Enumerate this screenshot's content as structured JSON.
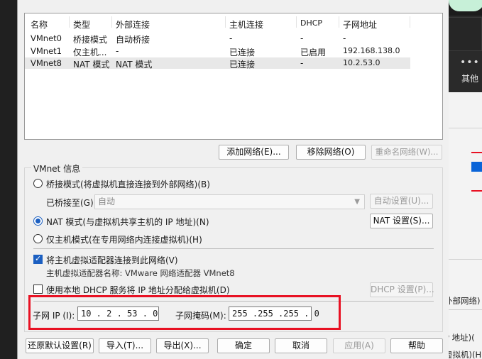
{
  "background_app": {
    "dots": "•••",
    "other_label": "其他",
    "text_right_1": "外部网络)",
    "text_right_2": "P 地址)(",
    "text_right_3": "虚拟机)(H"
  },
  "network_table": {
    "headers": [
      "名称",
      "类型",
      "外部连接",
      "主机连接",
      "DHCP",
      "子网地址"
    ],
    "rows": [
      {
        "name": "VMnet0",
        "type": "桥接模式",
        "external": "自动桥接",
        "host": "-",
        "dhcp": "-",
        "subnet": "-"
      },
      {
        "name": "VMnet1",
        "type": "仅主机...",
        "external": "-",
        "host": "已连接",
        "dhcp": "已启用",
        "subnet": "192.168.138.0"
      },
      {
        "name": "VMnet8",
        "type": "NAT 模式",
        "external": "NAT 模式",
        "host": "已连接",
        "dhcp": "-",
        "subnet": "10.2.53.0"
      }
    ],
    "selected_row": 2
  },
  "table_buttons": {
    "add": "添加网络(E)...",
    "remove": "移除网络(O)",
    "rename": "重命名网络(W)..."
  },
  "vmnet_info": {
    "title": "VMnet 信息",
    "bridge_mode": "桥接模式(将虚拟机直接连接到外部网络)(B)",
    "bridged_to_label": "已桥接至(G):",
    "bridged_to_value": "自动",
    "auto_settings": "自动设置(U)...",
    "nat_mode": "NAT 模式(与虚拟机共享主机的 IP 地址)(N)",
    "nat_settings": "NAT 设置(S)...",
    "host_only_mode": "仅主机模式(在专用网络内连接虚拟机)(H)",
    "connect_host_adapter": "将主机虚拟适配器连接到此网络(V)",
    "host_adapter_name": "主机虚拟适配器名称: VMware 网络适配器 VMnet8",
    "use_dhcp": "使用本地 DHCP 服务将 IP 地址分配给虚拟机(D)",
    "dhcp_settings": "DHCP 设置(P)...",
    "subnet_ip_label": "子网 IP (I):",
    "subnet_ip_value": "10 . 2 . 53 . 0",
    "subnet_mask_label": "子网掩码(M):",
    "subnet_mask_value": "255 .255 .255 . 0"
  },
  "bottom_buttons": {
    "restore_defaults": "还原默认设置(R)",
    "import": "导入(T)...",
    "export": "导出(X)...",
    "ok": "确定",
    "cancel": "取消",
    "apply": "应用(A)",
    "help": "帮助"
  },
  "colors": {
    "highlight_box": "#e81123",
    "accent": "#1b5fc1"
  }
}
